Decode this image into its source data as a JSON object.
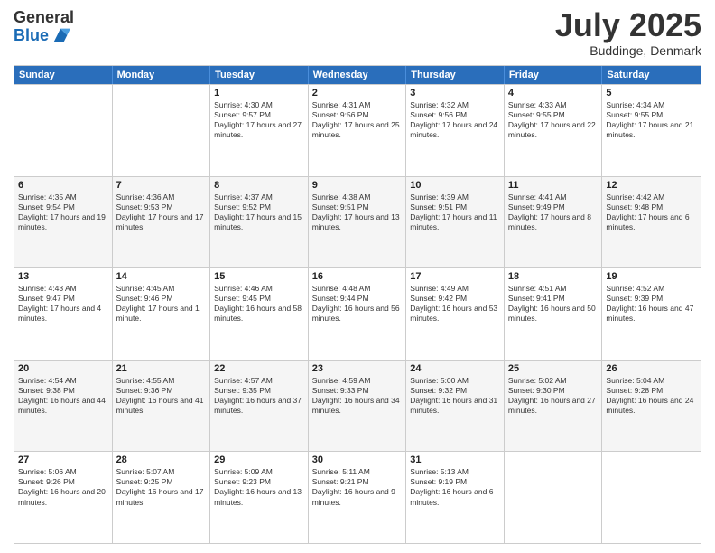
{
  "logo": {
    "general": "General",
    "blue": "Blue"
  },
  "header": {
    "month": "July 2025",
    "location": "Buddinge, Denmark"
  },
  "weekdays": [
    "Sunday",
    "Monday",
    "Tuesday",
    "Wednesday",
    "Thursday",
    "Friday",
    "Saturday"
  ],
  "weeks": [
    [
      {
        "day": "",
        "info": ""
      },
      {
        "day": "",
        "info": ""
      },
      {
        "day": "1",
        "info": "Sunrise: 4:30 AM\nSunset: 9:57 PM\nDaylight: 17 hours and 27 minutes."
      },
      {
        "day": "2",
        "info": "Sunrise: 4:31 AM\nSunset: 9:56 PM\nDaylight: 17 hours and 25 minutes."
      },
      {
        "day": "3",
        "info": "Sunrise: 4:32 AM\nSunset: 9:56 PM\nDaylight: 17 hours and 24 minutes."
      },
      {
        "day": "4",
        "info": "Sunrise: 4:33 AM\nSunset: 9:55 PM\nDaylight: 17 hours and 22 minutes."
      },
      {
        "day": "5",
        "info": "Sunrise: 4:34 AM\nSunset: 9:55 PM\nDaylight: 17 hours and 21 minutes."
      }
    ],
    [
      {
        "day": "6",
        "info": "Sunrise: 4:35 AM\nSunset: 9:54 PM\nDaylight: 17 hours and 19 minutes."
      },
      {
        "day": "7",
        "info": "Sunrise: 4:36 AM\nSunset: 9:53 PM\nDaylight: 17 hours and 17 minutes."
      },
      {
        "day": "8",
        "info": "Sunrise: 4:37 AM\nSunset: 9:52 PM\nDaylight: 17 hours and 15 minutes."
      },
      {
        "day": "9",
        "info": "Sunrise: 4:38 AM\nSunset: 9:51 PM\nDaylight: 17 hours and 13 minutes."
      },
      {
        "day": "10",
        "info": "Sunrise: 4:39 AM\nSunset: 9:51 PM\nDaylight: 17 hours and 11 minutes."
      },
      {
        "day": "11",
        "info": "Sunrise: 4:41 AM\nSunset: 9:49 PM\nDaylight: 17 hours and 8 minutes."
      },
      {
        "day": "12",
        "info": "Sunrise: 4:42 AM\nSunset: 9:48 PM\nDaylight: 17 hours and 6 minutes."
      }
    ],
    [
      {
        "day": "13",
        "info": "Sunrise: 4:43 AM\nSunset: 9:47 PM\nDaylight: 17 hours and 4 minutes."
      },
      {
        "day": "14",
        "info": "Sunrise: 4:45 AM\nSunset: 9:46 PM\nDaylight: 17 hours and 1 minute."
      },
      {
        "day": "15",
        "info": "Sunrise: 4:46 AM\nSunset: 9:45 PM\nDaylight: 16 hours and 58 minutes."
      },
      {
        "day": "16",
        "info": "Sunrise: 4:48 AM\nSunset: 9:44 PM\nDaylight: 16 hours and 56 minutes."
      },
      {
        "day": "17",
        "info": "Sunrise: 4:49 AM\nSunset: 9:42 PM\nDaylight: 16 hours and 53 minutes."
      },
      {
        "day": "18",
        "info": "Sunrise: 4:51 AM\nSunset: 9:41 PM\nDaylight: 16 hours and 50 minutes."
      },
      {
        "day": "19",
        "info": "Sunrise: 4:52 AM\nSunset: 9:39 PM\nDaylight: 16 hours and 47 minutes."
      }
    ],
    [
      {
        "day": "20",
        "info": "Sunrise: 4:54 AM\nSunset: 9:38 PM\nDaylight: 16 hours and 44 minutes."
      },
      {
        "day": "21",
        "info": "Sunrise: 4:55 AM\nSunset: 9:36 PM\nDaylight: 16 hours and 41 minutes."
      },
      {
        "day": "22",
        "info": "Sunrise: 4:57 AM\nSunset: 9:35 PM\nDaylight: 16 hours and 37 minutes."
      },
      {
        "day": "23",
        "info": "Sunrise: 4:59 AM\nSunset: 9:33 PM\nDaylight: 16 hours and 34 minutes."
      },
      {
        "day": "24",
        "info": "Sunrise: 5:00 AM\nSunset: 9:32 PM\nDaylight: 16 hours and 31 minutes."
      },
      {
        "day": "25",
        "info": "Sunrise: 5:02 AM\nSunset: 9:30 PM\nDaylight: 16 hours and 27 minutes."
      },
      {
        "day": "26",
        "info": "Sunrise: 5:04 AM\nSunset: 9:28 PM\nDaylight: 16 hours and 24 minutes."
      }
    ],
    [
      {
        "day": "27",
        "info": "Sunrise: 5:06 AM\nSunset: 9:26 PM\nDaylight: 16 hours and 20 minutes."
      },
      {
        "day": "28",
        "info": "Sunrise: 5:07 AM\nSunset: 9:25 PM\nDaylight: 16 hours and 17 minutes."
      },
      {
        "day": "29",
        "info": "Sunrise: 5:09 AM\nSunset: 9:23 PM\nDaylight: 16 hours and 13 minutes."
      },
      {
        "day": "30",
        "info": "Sunrise: 5:11 AM\nSunset: 9:21 PM\nDaylight: 16 hours and 9 minutes."
      },
      {
        "day": "31",
        "info": "Sunrise: 5:13 AM\nSunset: 9:19 PM\nDaylight: 16 hours and 6 minutes."
      },
      {
        "day": "",
        "info": ""
      },
      {
        "day": "",
        "info": ""
      }
    ]
  ]
}
